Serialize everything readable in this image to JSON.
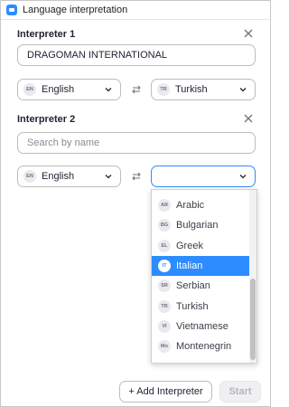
{
  "window": {
    "title": "Language interpretation"
  },
  "interpreter1": {
    "heading": "Interpreter 1",
    "name_value": "DRAGOMAN INTERNATIONAL",
    "from": {
      "code": "EN",
      "label": "English"
    },
    "to": {
      "code": "TR",
      "label": "Turkish"
    }
  },
  "interpreter2": {
    "heading": "Interpreter 2",
    "name_placeholder": "Search by name",
    "from": {
      "code": "EN",
      "label": "English"
    },
    "to": {
      "code": "",
      "label": ""
    }
  },
  "dropdown": {
    "items": [
      {
        "code": "AR",
        "label": "Arabic"
      },
      {
        "code": "BG",
        "label": "Bulgarian"
      },
      {
        "code": "EL",
        "label": "Greek"
      },
      {
        "code": "IT",
        "label": "Italian",
        "selected": true
      },
      {
        "code": "SR",
        "label": "Serbian"
      },
      {
        "code": "TR",
        "label": "Turkish"
      },
      {
        "code": "VI",
        "label": "Vietnamese"
      },
      {
        "code": "Mo",
        "label": "Montenegrin"
      }
    ]
  },
  "footer": {
    "add_label": "+ Add Interpreter",
    "start_label": "Start"
  },
  "colors": {
    "accent": "#2d8cff",
    "border": "#bdbdbd",
    "text": "#232333"
  }
}
